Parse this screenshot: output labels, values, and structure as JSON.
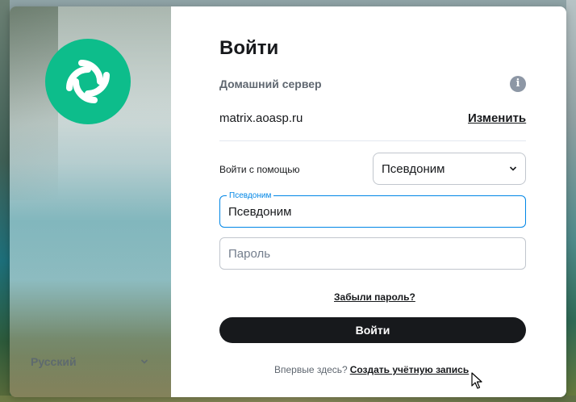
{
  "sidebar": {
    "language": "Русский",
    "logo_color": "#0dbd8b"
  },
  "form": {
    "title": "Войти",
    "homeserver_label": "Домашний сервер",
    "homeserver_value": "matrix.aoasp.ru",
    "change_link": "Изменить",
    "login_via_label": "Войти с помощью",
    "login_via_selected": "Псевдоним",
    "username_label": "Псевдоним",
    "username_value": "Псевдоним",
    "password_placeholder": "Пароль",
    "forgot_password": "Забыли пароль?",
    "login_button": "Войти",
    "new_here_text": "Впервые здесь?",
    "create_account_link": "Создать учётную запись"
  },
  "colors": {
    "accent": "#0dbd8b",
    "focus": "#0086e6",
    "primary_button": "#17191c"
  },
  "icons": [
    "element-logo-icon",
    "info-icon",
    "chevron-down-icon",
    "mouse-cursor-icon"
  ]
}
